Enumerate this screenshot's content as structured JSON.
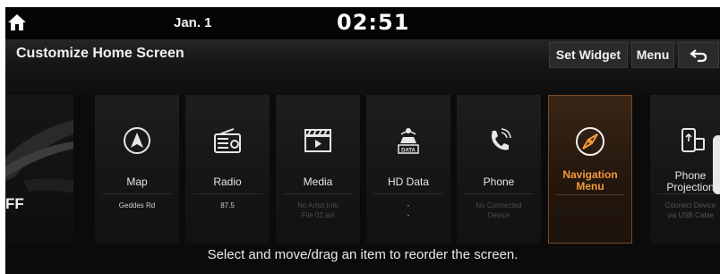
{
  "statusbar": {
    "date": "Jan. 1",
    "time": "02:51"
  },
  "titlebar": {
    "title": "Customize Home Screen",
    "set_widget": "Set Widget",
    "menu": "Menu"
  },
  "partial_left_text": "FF",
  "cards": [
    {
      "label": "Map",
      "sub": "Geddes Rd",
      "icon": "compass-arrow-icon"
    },
    {
      "label": "Radio",
      "sub": "87.5",
      "icon": "radio-icon"
    },
    {
      "label": "Media",
      "sub": "No Artist Info\nFile 02.avi",
      "icon": "media-icon"
    },
    {
      "label": "HD Data",
      "sub": "-\n-",
      "icon": "hd-data-icon"
    },
    {
      "label": "Phone",
      "sub": "No Connected\nDevice",
      "icon": "phone-icon"
    },
    {
      "label": "Navigation\nMenu",
      "sub": "",
      "icon": "navigation-compass-icon"
    },
    {
      "label": "Phone\nProjection",
      "sub": "Connect Device\nvia USB Cable",
      "icon": "phone-projection-icon"
    }
  ],
  "hint": "Select and move/drag an item to reorder the screen.",
  "colors": {
    "accent": "#f39a3e",
    "background": "#0b0b0b"
  }
}
